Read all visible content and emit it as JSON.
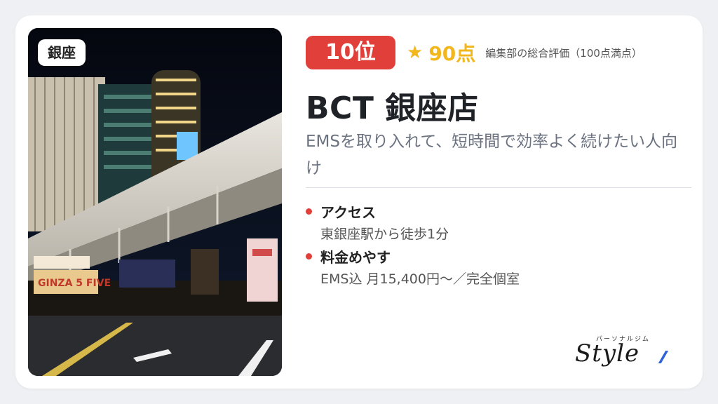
{
  "card": {
    "area_tag": "銀座",
    "rank": "10位",
    "score": "90点",
    "score_note": "編集部の総合評価（100点満点）",
    "title": "BCT 銀座店",
    "catch_copy": "EMSを取り入れて、短時間で効率よく続けたい人向け",
    "info": [
      {
        "label": "アクセス",
        "value": "東銀座駅から徒歩1分"
      },
      {
        "label": "料金めやす",
        "value": "EMS込 月15,400円〜／完全個室"
      }
    ]
  },
  "logo": {
    "kana": "パーソナルジム",
    "word": "Style"
  },
  "photo_signage": "GINZA 5 FIVE",
  "colors": {
    "accent_red": "#e1403a",
    "star_gold": "#f2b71c",
    "logo_blue": "#2f63d6"
  }
}
